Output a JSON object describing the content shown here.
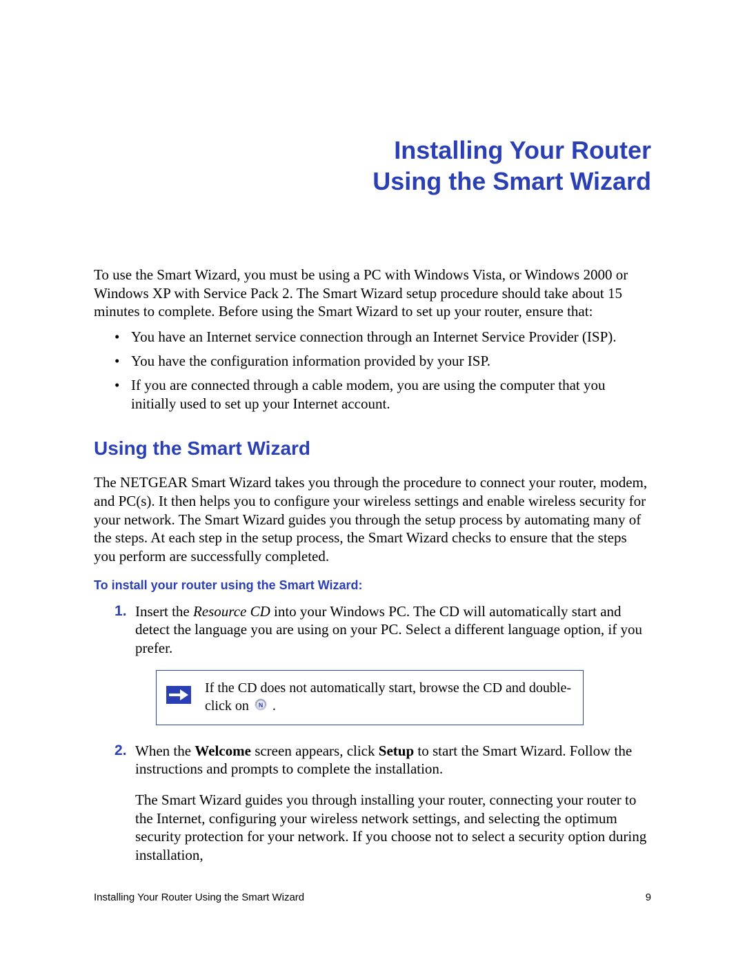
{
  "title_line1": "Installing Your Router",
  "title_line2": "Using the Smart Wizard",
  "intro_para": "To use the Smart Wizard, you must be using a PC with Windows Vista, or Windows 2000 or Windows XP with Service Pack 2. The Smart Wizard setup procedure should take about 15 minutes to complete. Before using the Smart Wizard to set up your router, ensure that:",
  "prereqs": [
    "You have an Internet service connection through an Internet Service Provider (ISP).",
    "You have the configuration information provided by your ISP.",
    "If you are connected through a cable modem, you are using the computer that you initially used to set up your Internet account."
  ],
  "section_heading": "Using the Smart Wizard",
  "section_para": "The NETGEAR Smart Wizard takes you through the procedure to connect your router, modem, and PC(s). It then helps you to configure your wireless settings and enable wireless security for your network. The Smart Wizard guides you through the setup process by automating many of the steps. At each step in the setup process, the Smart Wizard checks to ensure that the steps you perform are successfully completed.",
  "sub_instruction": "To install your router using the Smart Wizard:",
  "step1_prefix": "Insert the ",
  "step1_italic": "Resource CD",
  "step1_suffix": " into your Windows PC. The CD will automatically start and detect the language you are using on your PC. Select a different language option, if you prefer.",
  "note_text_prefix": "If the CD does not automatically start, browse the CD and double-click on ",
  "note_text_suffix": " .",
  "step2_a": "When the ",
  "step2_bold1": "Welcome",
  "step2_b": " screen appears, click ",
  "step2_bold2": "Setup",
  "step2_c": " to start the Smart Wizard. Follow the instructions and prompts to complete the installation.",
  "step2_cont": "The Smart Wizard guides you through installing your router, connecting your router to the Internet, configuring your wireless network settings, and selecting the optimum security protection for your network. If you choose not to select a security option during installation,",
  "footer_left": "Installing Your Router Using the Smart Wizard",
  "footer_right": "9",
  "colors": {
    "accent": "#2b3fb5"
  }
}
